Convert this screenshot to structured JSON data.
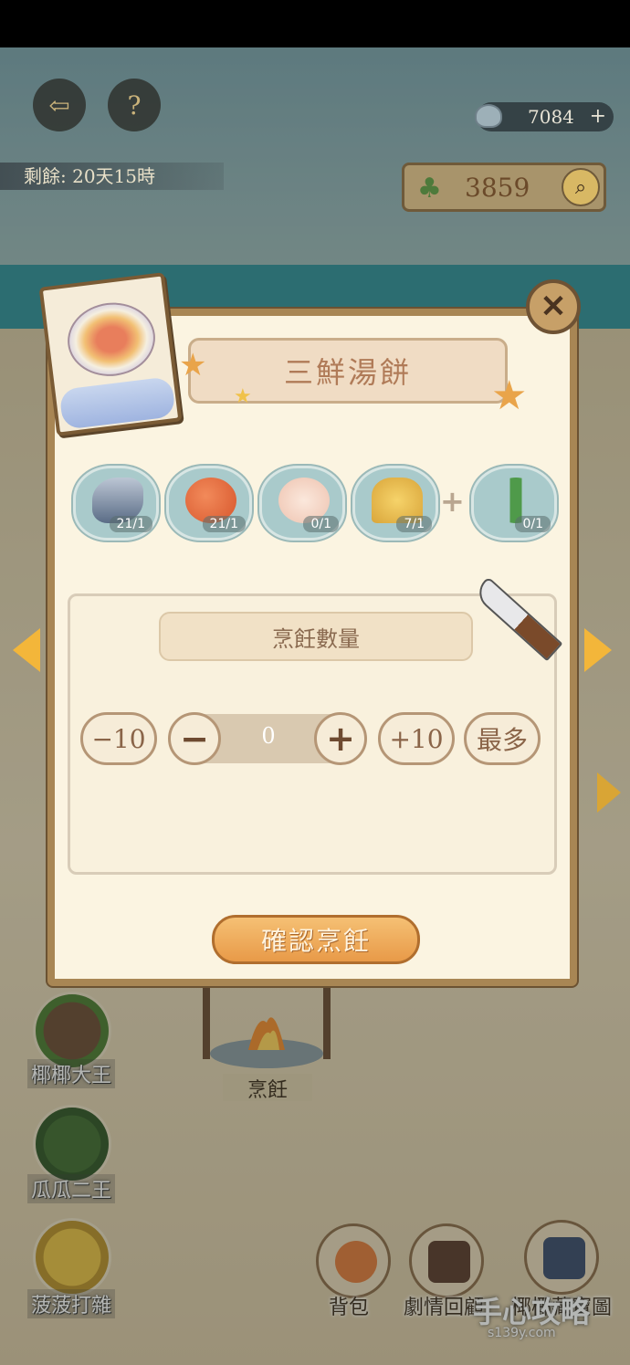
{
  "hud": {
    "time_remaining": "剩餘: 20天15時",
    "shells": "7084",
    "shells_plus": "+",
    "coins": "3859",
    "help": "?"
  },
  "recipe": {
    "title": "三鮮湯餅",
    "ingredients": [
      {
        "name": "fish",
        "count": "21/1"
      },
      {
        "name": "shrimp",
        "count": "21/1"
      },
      {
        "name": "chicken",
        "count": "0/1"
      },
      {
        "name": "wheat",
        "count": "7/1"
      },
      {
        "name": "scallion",
        "count": "0/1"
      }
    ],
    "plus": "+"
  },
  "quantity": {
    "label": "烹飪數量",
    "minus10": "−10",
    "value": "0",
    "plus10": "+10",
    "max": "最多",
    "minus": "−",
    "plus": "+"
  },
  "confirm_label": "確認烹飪",
  "characters": [
    {
      "label": "椰椰大王"
    },
    {
      "label": "瓜瓜二王"
    },
    {
      "label": "菠菠打雜"
    }
  ],
  "cook_label": "烹飪",
  "bottom_menu": [
    {
      "label": "背包"
    },
    {
      "label": "劇情回顧"
    },
    {
      "label": "椰椰藏寶圖"
    }
  ],
  "watermark": {
    "big": "手心攻略",
    "small": "s139y.com"
  },
  "colors": {
    "accent": "#f3b63a",
    "panel": "#fbf4e1",
    "border": "#a88654"
  }
}
